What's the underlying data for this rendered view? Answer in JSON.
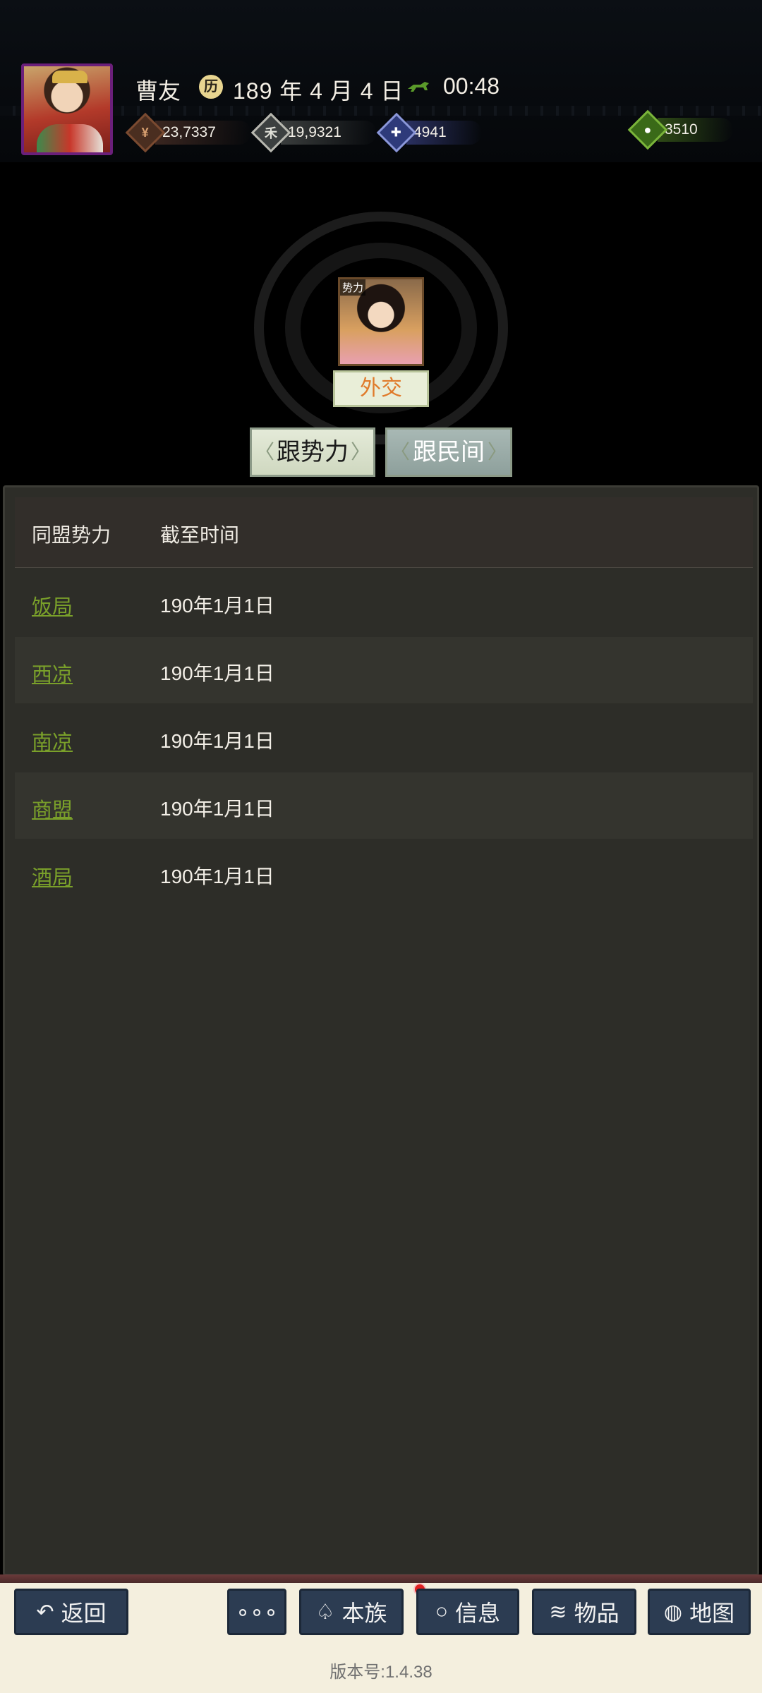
{
  "header": {
    "player_name": "曹友",
    "date": "189 年 4 月 4 日",
    "date_icon": "calendar-seal-icon",
    "time": "00:48",
    "resources": [
      {
        "name": "gold",
        "icon": "coin-icon",
        "value": "23,7337",
        "color": "#7a4a30"
      },
      {
        "name": "grain",
        "icon": "grain-icon",
        "value": "19,9321",
        "color": "#b8b8b0"
      },
      {
        "name": "troops",
        "icon": "soldier-icon",
        "value": "4941",
        "color": "#8a96d8"
      },
      {
        "name": "special",
        "icon": "pouch-icon",
        "value": "3510",
        "color": "#7ab43a"
      }
    ]
  },
  "faction": {
    "tag": "势力",
    "diplomacy_label": "外交"
  },
  "tabs": {
    "faction": "跟势力",
    "people": "跟民间"
  },
  "table": {
    "headers": {
      "ally": "同盟势力",
      "until": "截至时间"
    },
    "rows": [
      {
        "faction": "饭局",
        "until": "190年1月1日"
      },
      {
        "faction": "西凉",
        "until": "190年1月1日"
      },
      {
        "faction": "南凉",
        "until": "190年1月1日"
      },
      {
        "faction": "商盟",
        "until": "190年1月1日"
      },
      {
        "faction": "酒局",
        "until": "190年1月1日"
      }
    ]
  },
  "nav": {
    "back": "返回",
    "more": "∘∘∘",
    "clan": "本族",
    "messages": "信息",
    "items": "物品",
    "map": "地图"
  },
  "footer": {
    "version": "版本号:1.4.38"
  },
  "colors": {
    "link_green": "#7aa02a",
    "panel_bg": "#2d2d28",
    "nav_bg": "#2c3c52",
    "diplomacy_orange": "#e07a2a"
  }
}
